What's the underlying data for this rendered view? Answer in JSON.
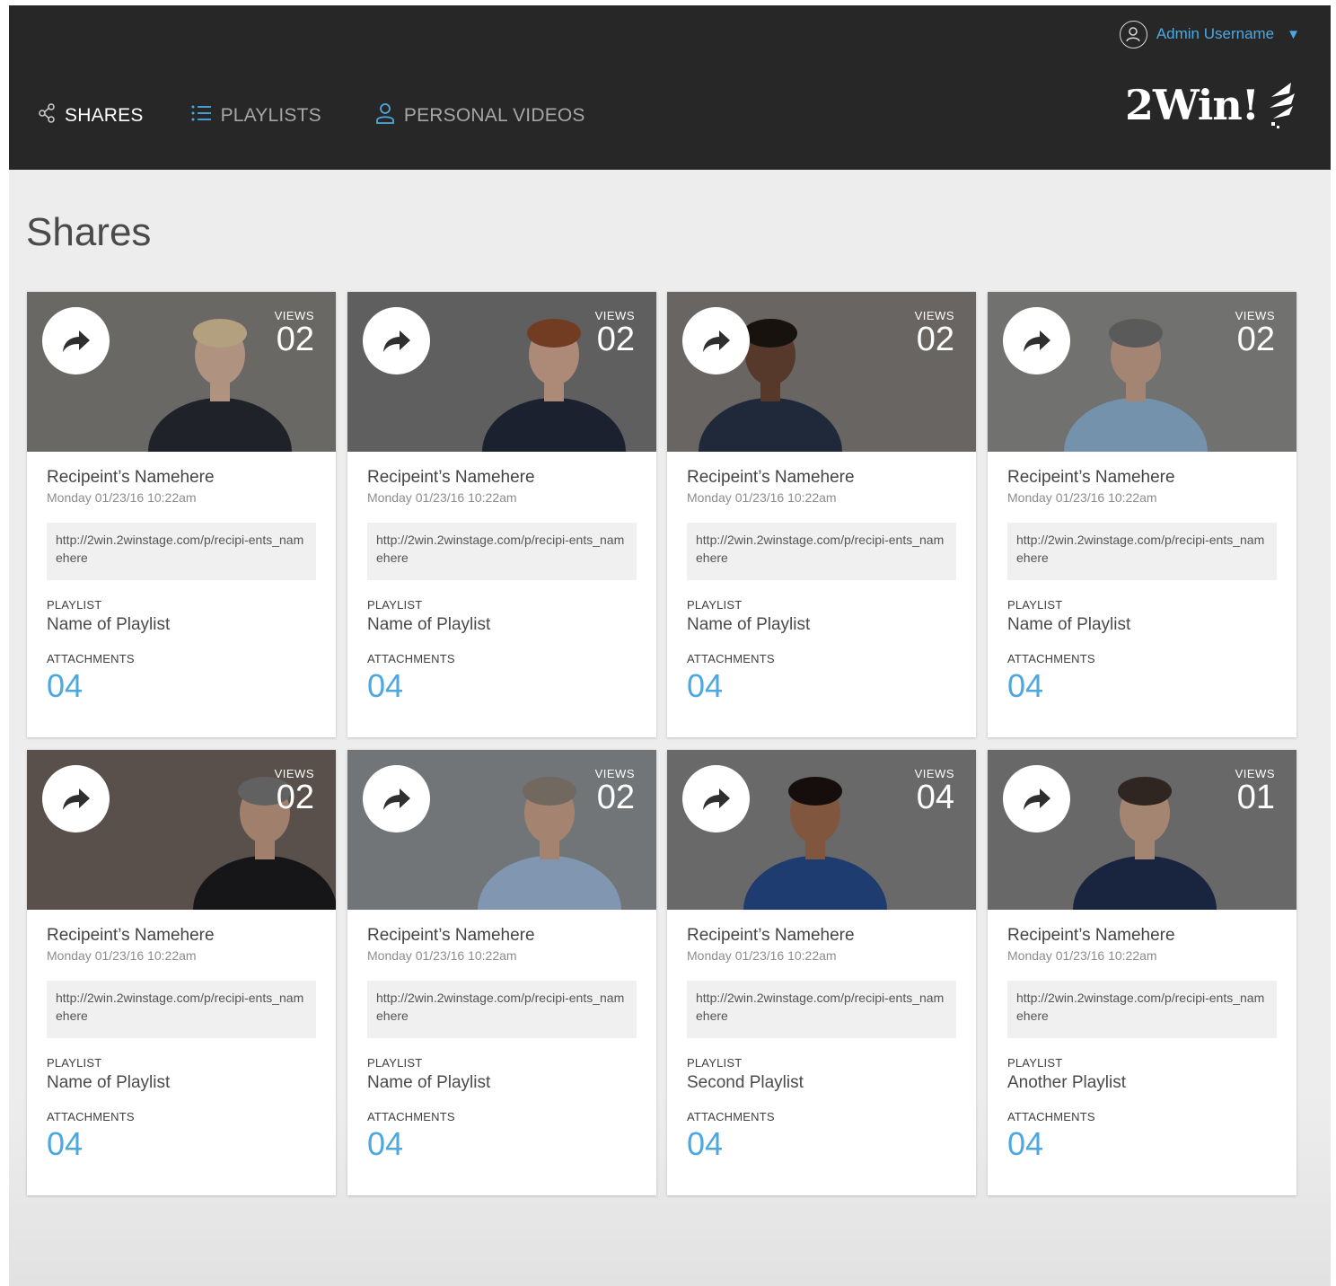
{
  "header": {
    "user_name": "Admin Username",
    "nav": [
      {
        "label": "SHARES",
        "icon": "share-icon",
        "active": true
      },
      {
        "label": "PLAYLISTS",
        "icon": "list-icon",
        "active": false
      },
      {
        "label": "PERSONAL VIDEOS",
        "icon": "person-icon",
        "active": false
      }
    ],
    "logo": "2Win!"
  },
  "page": {
    "title": "Shares"
  },
  "labels": {
    "views": "VIEWS",
    "playlist": "PLAYLIST",
    "attachments": "ATTACHMENTS"
  },
  "colors": {
    "accent": "#4ea8e0",
    "header_bg": "#272727",
    "page_bg": "#ededed"
  },
  "cards": [
    {
      "recipient": "Recipeint’s Namehere",
      "date": "Monday 01/23/16 10:22am",
      "url": "http://2win.2winstage.com/p/recipi-ents_namehere",
      "playlist": "Name of Playlist",
      "attachments": "04",
      "views": "02"
    },
    {
      "recipient": "Recipeint’s Namehere",
      "date": "Monday 01/23/16 10:22am",
      "url": "http://2win.2winstage.com/p/recipi-ents_namehere",
      "playlist": "Name of Playlist",
      "attachments": "04",
      "views": "02"
    },
    {
      "recipient": "Recipeint’s Namehere",
      "date": "Monday 01/23/16 10:22am",
      "url": "http://2win.2winstage.com/p/recipi-ents_namehere",
      "playlist": "Name of Playlist",
      "attachments": "04",
      "views": "02"
    },
    {
      "recipient": "Recipeint’s Namehere",
      "date": "Monday 01/23/16 10:22am",
      "url": "http://2win.2winstage.com/p/recipi-ents_namehere",
      "playlist": "Name of Playlist",
      "attachments": "04",
      "views": "02"
    },
    {
      "recipient": "Recipeint’s Namehere",
      "date": "Monday 01/23/16 10:22am",
      "url": "http://2win.2winstage.com/p/recipi-ents_namehere",
      "playlist": "Name of Playlist",
      "attachments": "04",
      "views": "02"
    },
    {
      "recipient": "Recipeint’s Namehere",
      "date": "Monday 01/23/16 10:22am",
      "url": "http://2win.2winstage.com/p/recipi-ents_namehere",
      "playlist": "Name of Playlist",
      "attachments": "04",
      "views": "02"
    },
    {
      "recipient": "Recipeint’s Namehere",
      "date": "Monday 01/23/16 10:22am",
      "url": "http://2win.2winstage.com/p/recipi-ents_namehere",
      "playlist": "Second Playlist",
      "attachments": "04",
      "views": "04"
    },
    {
      "recipient": "Recipeint’s Namehere",
      "date": "Monday 01/23/16 10:22am",
      "url": "http://2win.2winstage.com/p/recipi-ents_namehere",
      "playlist": "Another Playlist",
      "attachments": "04",
      "views": "01"
    }
  ]
}
